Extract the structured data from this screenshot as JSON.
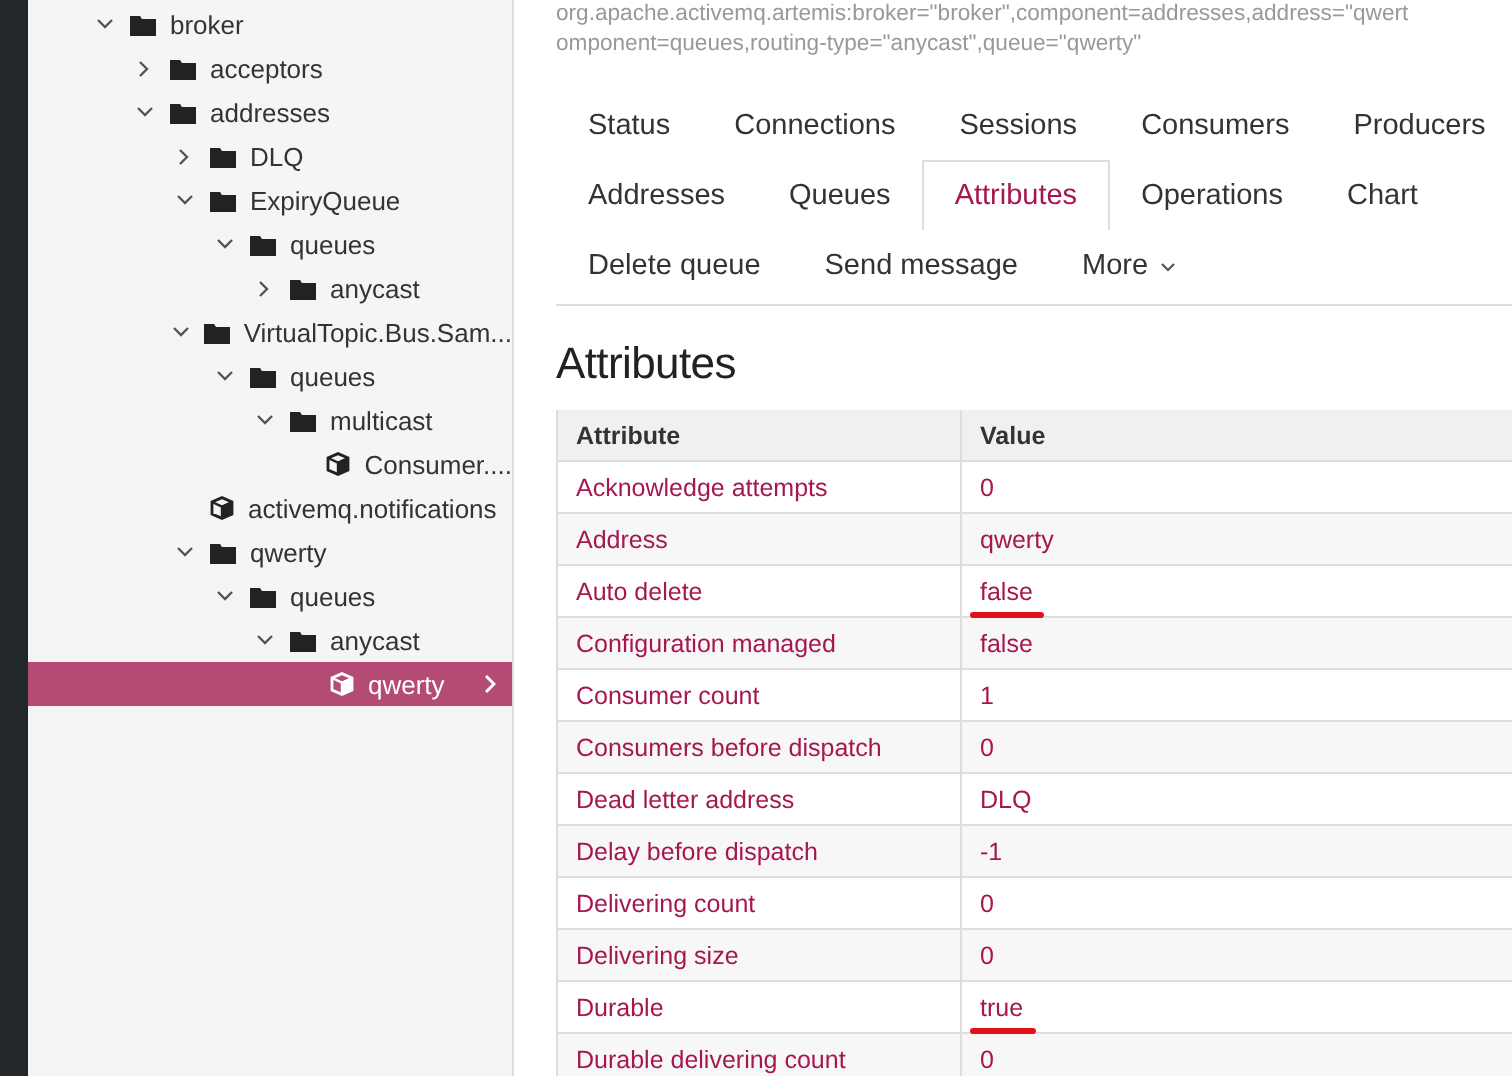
{
  "tree": [
    {
      "label": "broker",
      "kind": "folder",
      "expanded": true,
      "selected": false,
      "children": [
        {
          "label": "acceptors",
          "kind": "folder",
          "expanded": false,
          "selected": false
        },
        {
          "label": "addresses",
          "kind": "folder",
          "expanded": true,
          "selected": false,
          "children": [
            {
              "label": "DLQ",
              "kind": "folder",
              "expanded": false,
              "selected": false
            },
            {
              "label": "ExpiryQueue",
              "kind": "folder",
              "expanded": true,
              "selected": false,
              "children": [
                {
                  "label": "queues",
                  "kind": "folder",
                  "expanded": true,
                  "selected": false,
                  "children": [
                    {
                      "label": "anycast",
                      "kind": "folder",
                      "expanded": false,
                      "selected": false
                    }
                  ]
                }
              ]
            },
            {
              "label": "VirtualTopic.Bus.Sam...",
              "kind": "folder",
              "expanded": true,
              "selected": false,
              "children": [
                {
                  "label": "queues",
                  "kind": "folder",
                  "expanded": true,
                  "selected": false,
                  "children": [
                    {
                      "label": "multicast",
                      "kind": "folder",
                      "expanded": true,
                      "selected": false,
                      "children": [
                        {
                          "label": "Consumer....",
                          "kind": "queue",
                          "selected": false
                        }
                      ]
                    }
                  ]
                }
              ]
            },
            {
              "label": "activemq.notifications",
              "kind": "queue",
              "selected": false
            },
            {
              "label": "qwerty",
              "kind": "folder",
              "expanded": true,
              "selected": false,
              "children": [
                {
                  "label": "queues",
                  "kind": "folder",
                  "expanded": true,
                  "selected": false,
                  "children": [
                    {
                      "label": "anycast",
                      "kind": "folder",
                      "expanded": true,
                      "selected": false,
                      "children": [
                        {
                          "label": "qwerty",
                          "kind": "queue",
                          "selected": true
                        }
                      ]
                    }
                  ]
                }
              ]
            }
          ]
        }
      ]
    }
  ],
  "object_name": [
    "org.apache.activemq.artemis:broker=\"broker\",component=addresses,address=\"qwert",
    "omponent=queues,routing-type=\"anycast\",queue=\"qwerty\""
  ],
  "tab_rows": [
    [
      {
        "label": "Status",
        "kind": "tab",
        "selected": false
      },
      {
        "label": "Connections",
        "kind": "tab",
        "selected": false
      },
      {
        "label": "Sessions",
        "kind": "tab",
        "selected": false
      },
      {
        "label": "Consumers",
        "kind": "tab",
        "selected": false
      },
      {
        "label": "Producers",
        "kind": "tab",
        "selected": false
      }
    ],
    [
      {
        "label": "Addresses",
        "kind": "tab",
        "selected": false
      },
      {
        "label": "Queues",
        "kind": "tab",
        "selected": false
      },
      {
        "label": "Attributes",
        "kind": "tab",
        "selected": true
      },
      {
        "label": "Operations",
        "kind": "tab",
        "selected": false
      },
      {
        "label": "Chart",
        "kind": "tab",
        "selected": false
      }
    ],
    [
      {
        "label": "Delete queue",
        "kind": "tab",
        "selected": false
      },
      {
        "label": "Send message",
        "kind": "tab",
        "selected": false
      },
      {
        "label": "More",
        "kind": "dropdown",
        "selected": false
      }
    ]
  ],
  "heading": "Attributes",
  "table": {
    "columns": [
      "Attribute",
      "Value"
    ],
    "rows": [
      {
        "attribute": "Acknowledge attempts",
        "value": "0",
        "underlined": false
      },
      {
        "attribute": "Address",
        "value": "qwerty",
        "underlined": false
      },
      {
        "attribute": "Auto delete",
        "value": "false",
        "underlined": true
      },
      {
        "attribute": "Configuration managed",
        "value": "false",
        "underlined": false
      },
      {
        "attribute": "Consumer count",
        "value": "1",
        "underlined": false
      },
      {
        "attribute": "Consumers before dispatch",
        "value": "0",
        "underlined": false
      },
      {
        "attribute": "Dead letter address",
        "value": "DLQ",
        "underlined": false
      },
      {
        "attribute": "Delay before dispatch",
        "value": "-1",
        "underlined": false
      },
      {
        "attribute": "Delivering count",
        "value": "0",
        "underlined": false
      },
      {
        "attribute": "Delivering size",
        "value": "0",
        "underlined": false
      },
      {
        "attribute": "Durable",
        "value": "true",
        "underlined": true
      },
      {
        "attribute": "Durable delivering count",
        "value": "0",
        "underlined": false
      }
    ]
  }
}
